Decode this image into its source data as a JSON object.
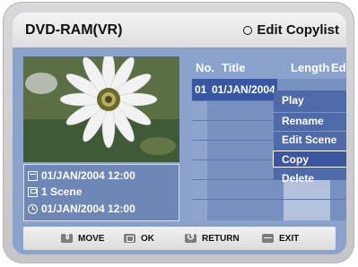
{
  "header": {
    "disc_type": "DVD-RAM(VR)",
    "mode": "Edit Copylist"
  },
  "thumbnail": {
    "subject": "flower photo"
  },
  "info": {
    "date": "01/JAN/2004 12:00",
    "scenes": "1 Scene",
    "time": "01/JAN/2004 12:00"
  },
  "list": {
    "columns": {
      "no": "No.",
      "title": "Title",
      "length": "Length",
      "edit": "Edit"
    },
    "rows": [
      {
        "no": "01",
        "title": "01/JAN/2004 12:00",
        "selected": true
      }
    ]
  },
  "menu": {
    "items": [
      "Play",
      "Rename",
      "Edit Scene",
      "Copy",
      "Delete"
    ],
    "active": "Copy"
  },
  "footer": {
    "move": "MOVE",
    "ok": "OK",
    "return": "RETURN",
    "exit": "EXIT"
  },
  "colors": {
    "screen_bg": "#8aa2cc",
    "selection": "#3857a2",
    "menu_bg": "#4f6aa8"
  }
}
